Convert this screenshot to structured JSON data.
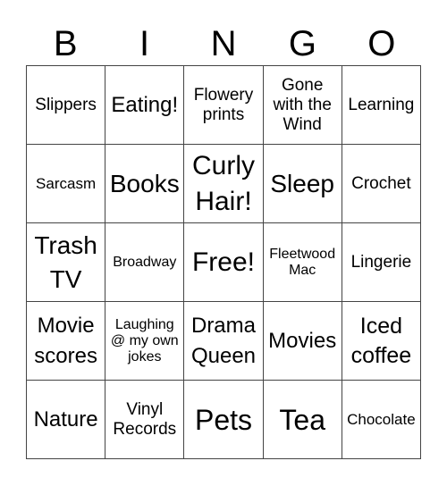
{
  "header": {
    "letters": [
      "B",
      "I",
      "N",
      "G",
      "O"
    ]
  },
  "cells": [
    [
      "Slippers",
      "Eating!",
      "Flowery prints",
      "Gone with the Wind",
      "Learning"
    ],
    [
      "Sarcasm",
      "Books",
      "Curly Hair!",
      "Sleep",
      "Crochet"
    ],
    [
      "Trash TV",
      "Broadway",
      "Free!",
      "Fleetwood Mac",
      "Lingerie"
    ],
    [
      "Movie scores",
      "Laughing @ my own jokes",
      "Drama Queen",
      "Movies",
      "Iced coffee"
    ],
    [
      "Nature",
      "Vinyl Records",
      "Pets",
      "Tea",
      "Chocolate"
    ]
  ]
}
